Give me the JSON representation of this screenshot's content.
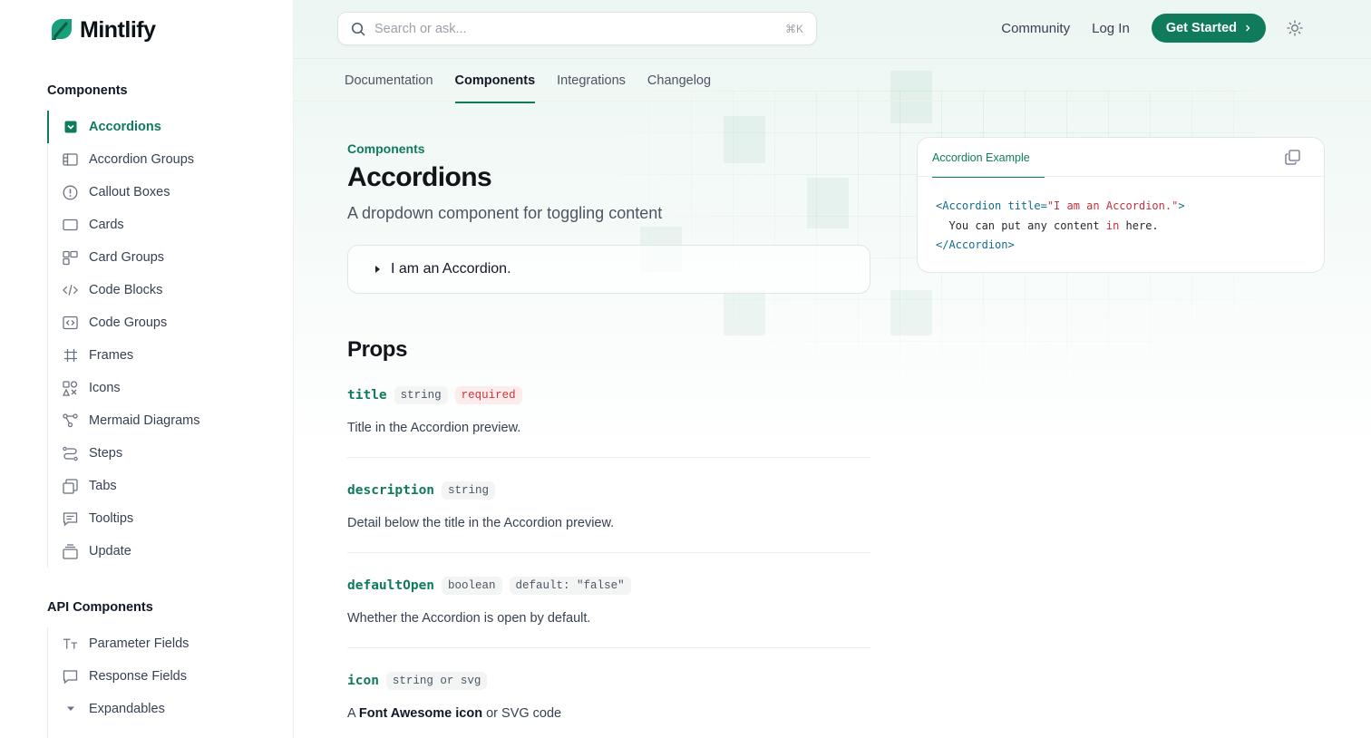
{
  "brand": {
    "name": "Mintlify",
    "accent": "#0f7b5c"
  },
  "header": {
    "search_placeholder": "Search or ask...",
    "search_shortcut": "⌘K",
    "links": {
      "community": "Community",
      "login": "Log In",
      "get_started": "Get Started"
    }
  },
  "tabs": [
    {
      "label": "Documentation",
      "active": false
    },
    {
      "label": "Components",
      "active": true
    },
    {
      "label": "Integrations",
      "active": false
    },
    {
      "label": "Changelog",
      "active": false
    }
  ],
  "sidebar": {
    "sections": [
      {
        "title": "Components",
        "items": [
          {
            "label": "Accordions",
            "icon": "accordion-icon",
            "active": true
          },
          {
            "label": "Accordion Groups",
            "icon": "accordion-groups-icon"
          },
          {
            "label": "Callout Boxes",
            "icon": "alert-circle-icon"
          },
          {
            "label": "Cards",
            "icon": "card-icon"
          },
          {
            "label": "Card Groups",
            "icon": "card-groups-icon"
          },
          {
            "label": "Code Blocks",
            "icon": "code-icon"
          },
          {
            "label": "Code Groups",
            "icon": "code-group-icon"
          },
          {
            "label": "Frames",
            "icon": "frame-icon"
          },
          {
            "label": "Icons",
            "icon": "icons-icon"
          },
          {
            "label": "Mermaid Diagrams",
            "icon": "diagram-icon"
          },
          {
            "label": "Steps",
            "icon": "steps-icon"
          },
          {
            "label": "Tabs",
            "icon": "tabs-icon"
          },
          {
            "label": "Tooltips",
            "icon": "tooltip-icon"
          },
          {
            "label": "Update",
            "icon": "update-icon"
          }
        ]
      },
      {
        "title": "API Components",
        "items": [
          {
            "label": "Parameter Fields",
            "icon": "text-icon"
          },
          {
            "label": "Response Fields",
            "icon": "message-icon"
          },
          {
            "label": "Expandables",
            "icon": "caret-down-icon"
          }
        ]
      }
    ]
  },
  "main": {
    "eyebrow": "Components",
    "title": "Accordions",
    "subtitle": "A dropdown component for toggling content",
    "accordion_label": "I am an Accordion.",
    "props_title": "Props",
    "props": [
      {
        "name": "title",
        "type": "string",
        "extra": "required",
        "desc": "Title in the Accordion preview."
      },
      {
        "name": "description",
        "type": "string",
        "desc": "Detail below the title in the Accordion preview."
      },
      {
        "name": "defaultOpen",
        "type": "boolean",
        "extra": "default: \"false\"",
        "desc": "Whether the Accordion is open by default."
      },
      {
        "name": "icon",
        "type": "string or svg",
        "desc_bold": "Font Awesome icon",
        "desc_prefix": "A ",
        "desc_suffix": " or SVG code"
      }
    ]
  },
  "code_panel": {
    "tab_label": "Accordion Example",
    "lines": {
      "l1_open": "<Accordion title=",
      "l1_str": "\"I am an Accordion.\"",
      "l1_close": ">",
      "l2_a": "  You can put any content ",
      "l2_kw": "in",
      "l2_b": " here.",
      "l3": "</Accordion>"
    }
  }
}
